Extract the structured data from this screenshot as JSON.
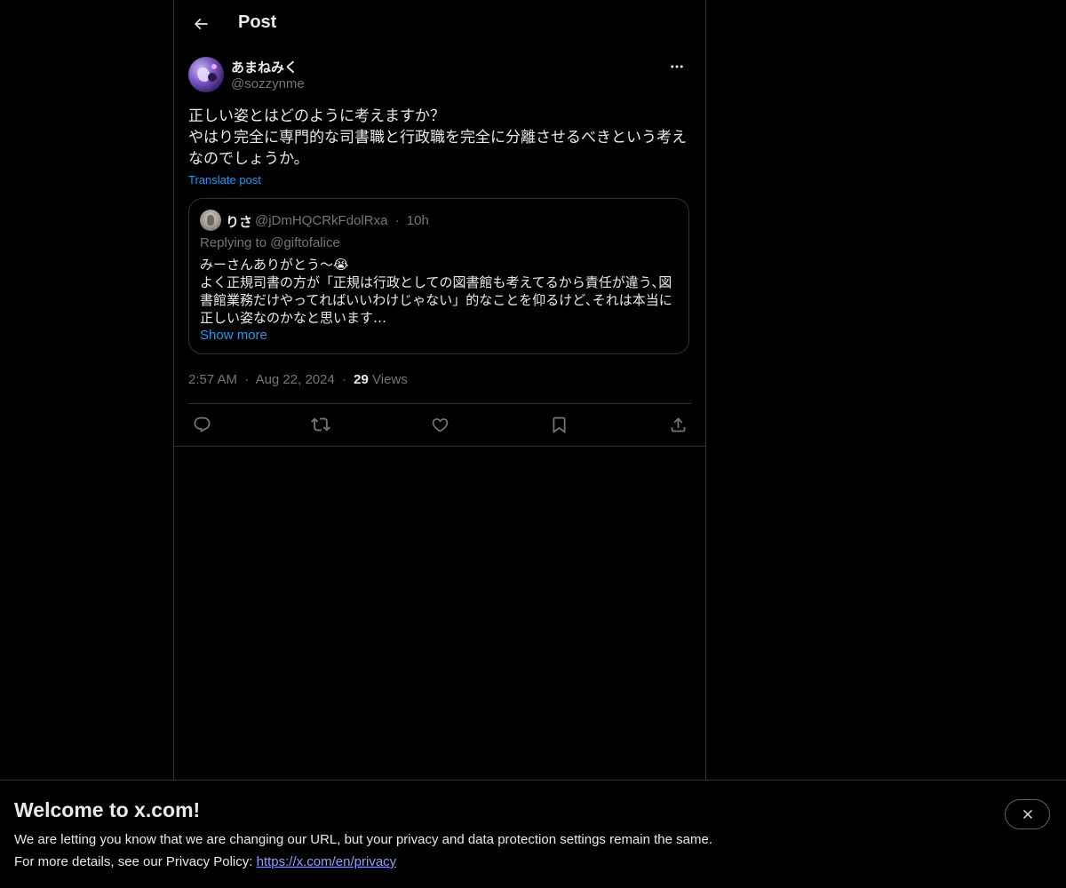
{
  "header": {
    "title": "Post"
  },
  "post": {
    "author": {
      "display_name": "あまねみく",
      "handle": "@sozzynme"
    },
    "text": "正しい姿とはどのように考えますか？\nやはり完全に専門的な司書職と行政職を完全に分離させるべきという考えなのでしょうか。",
    "translate_label": "Translate post",
    "time": "2:57 AM",
    "date": "Aug 22, 2024",
    "views_count": "29",
    "views_label": "Views",
    "dot": "·"
  },
  "quote": {
    "display_name": "りさ",
    "handle": "@jDmHQCRkFdolRxa",
    "time": "10h",
    "replying_label": "Replying to",
    "replying_to": "@giftofalice",
    "text": "みーさんありがとう〜😭\nよく正規司書の方が「正規は行政としての図書館も考えてるから責任が違う､図書館業務だけやってればいいわけじゃない」的なことを仰るけど､それは本当に正しい姿なのかなと思います…",
    "show_more": "Show more"
  },
  "actions": {
    "icons": [
      "reply-icon",
      "repost-icon",
      "like-icon",
      "bookmark-icon",
      "share-icon"
    ]
  },
  "banner": {
    "title": "Welcome to x.com!",
    "line1": "We are letting you know that we are changing our URL, but your privacy and data protection settings remain the same.",
    "line2_prefix": "For more details, see our Privacy Policy:",
    "link": "https://x.com/en/privacy"
  },
  "colors": {
    "background": "#000000",
    "text": "#e7e9ea",
    "secondary": "#71767b",
    "accent": "#1d9bf0",
    "border": "#2f3336",
    "link": "#8f9dff"
  }
}
